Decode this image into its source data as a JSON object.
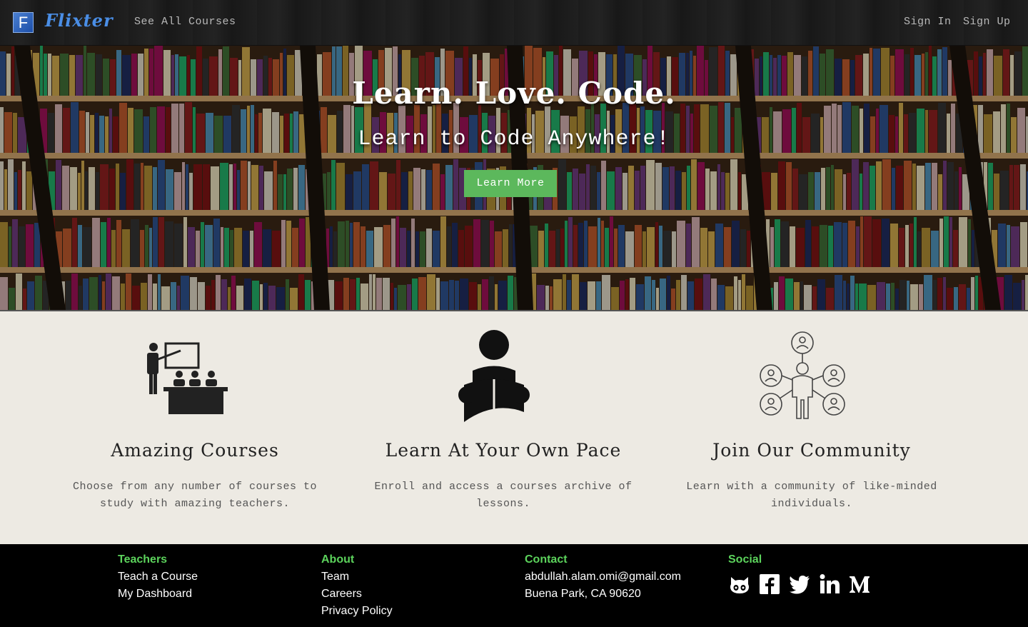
{
  "nav": {
    "logo_letter": "F",
    "brand": "Flixter",
    "all_courses": "See All Courses",
    "sign_in": "Sign In",
    "sign_up": "Sign Up"
  },
  "hero": {
    "title": "Learn. Love. Code.",
    "subtitle": "Learn to Code Anywhere!",
    "button": "Learn More"
  },
  "features": [
    {
      "title": "Amazing Courses",
      "text": "Choose from any number of courses to study with amazing teachers.",
      "icon": "teacher-classroom-icon"
    },
    {
      "title": "Learn At Your Own Pace",
      "text": "Enroll and access a courses archive of lessons.",
      "icon": "reader-icon"
    },
    {
      "title": "Join Our Community",
      "text": "Learn with a community of like-minded individuals.",
      "icon": "community-network-icon"
    }
  ],
  "footer": {
    "teachers": {
      "heading": "Teachers",
      "links": [
        "Teach a Course",
        "My Dashboard"
      ]
    },
    "about": {
      "heading": "About",
      "links": [
        "Team",
        "Careers",
        "Privacy Policy"
      ]
    },
    "contact": {
      "heading": "Contact",
      "lines": [
        "abdullah.alam.omi@gmail.com",
        "Buena Park, CA 90620"
      ]
    },
    "social": {
      "heading": "Social",
      "icons": [
        "github-icon",
        "facebook-icon",
        "twitter-icon",
        "linkedin-icon",
        "medium-icon"
      ]
    }
  },
  "colors": {
    "accent_green": "#5cb85c",
    "footer_heading": "#5cd35c",
    "brand_blue": "#4a8ee6"
  }
}
